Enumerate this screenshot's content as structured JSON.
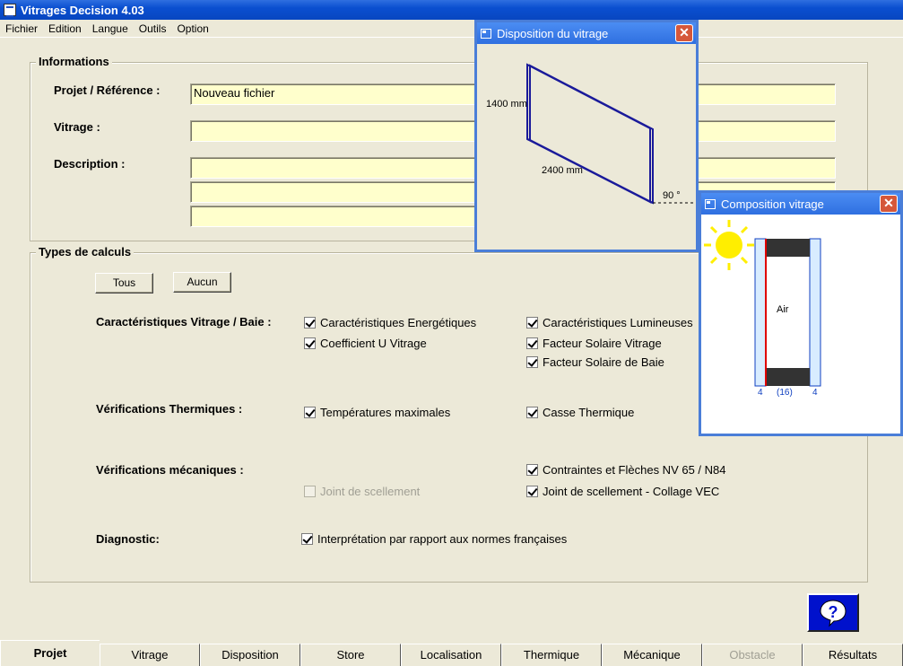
{
  "app": {
    "title": "Vitrages Decision 4.03"
  },
  "menu": [
    "Fichier",
    "Edition",
    "Langue",
    "Outils",
    "Option"
  ],
  "informations": {
    "legend": "Informations",
    "projet_label": "Projet / Référence :",
    "projet_value": "Nouveau fichier",
    "vitrage_label": "Vitrage :",
    "vitrage_value": "",
    "description_label": "Description :",
    "description_lines": [
      "",
      "",
      ""
    ]
  },
  "calculs": {
    "legend": "Types de calculs",
    "tous": "Tous",
    "aucun": "Aucun",
    "caract_label": "Caractéristiques Vitrage / Baie :",
    "caract_energ": "Caractéristiques Energétiques",
    "caract_lum": "Caractéristiques Lumineuses",
    "coef_u": "Coefficient U Vitrage",
    "facteur_solaire_vitrage": "Facteur Solaire Vitrage",
    "facteur_solaire_baie": "Facteur Solaire de Baie",
    "therm_label": "Vérifications Thermiques :",
    "temp_max": "Températures maximales",
    "casse_therm": "Casse Thermique",
    "meca_label": "Vérifications mécaniques :",
    "contraintes": "Contraintes et Flèches NV 65 / N84",
    "joint_scellement": "Joint de scellement",
    "joint_collage": "Joint de scellement - Collage VEC",
    "diag_label": "Diagnostic:",
    "interpretation": "Interprétation par rapport aux normes françaises"
  },
  "disposition": {
    "title": "Disposition du vitrage",
    "height": "1400 mm",
    "width": "2400 mm",
    "angle": "90 °"
  },
  "composition": {
    "title": "Composition vitrage",
    "gas": "Air",
    "left_thickness": "4",
    "gap": "(16)",
    "right_thickness": "4"
  },
  "tabs": [
    "Projet",
    "Vitrage",
    "Disposition",
    "Store",
    "Localisation",
    "Thermique",
    "Mécanique",
    "Obstacle",
    "Résultats"
  ],
  "colors": {
    "field_bg": "#ffffcc",
    "title_blue": "#0a4fd0",
    "glass_blue": "#1a1a9a"
  },
  "icons": {
    "help": "question-icon",
    "close": "close-icon",
    "sun": "sun-icon"
  }
}
